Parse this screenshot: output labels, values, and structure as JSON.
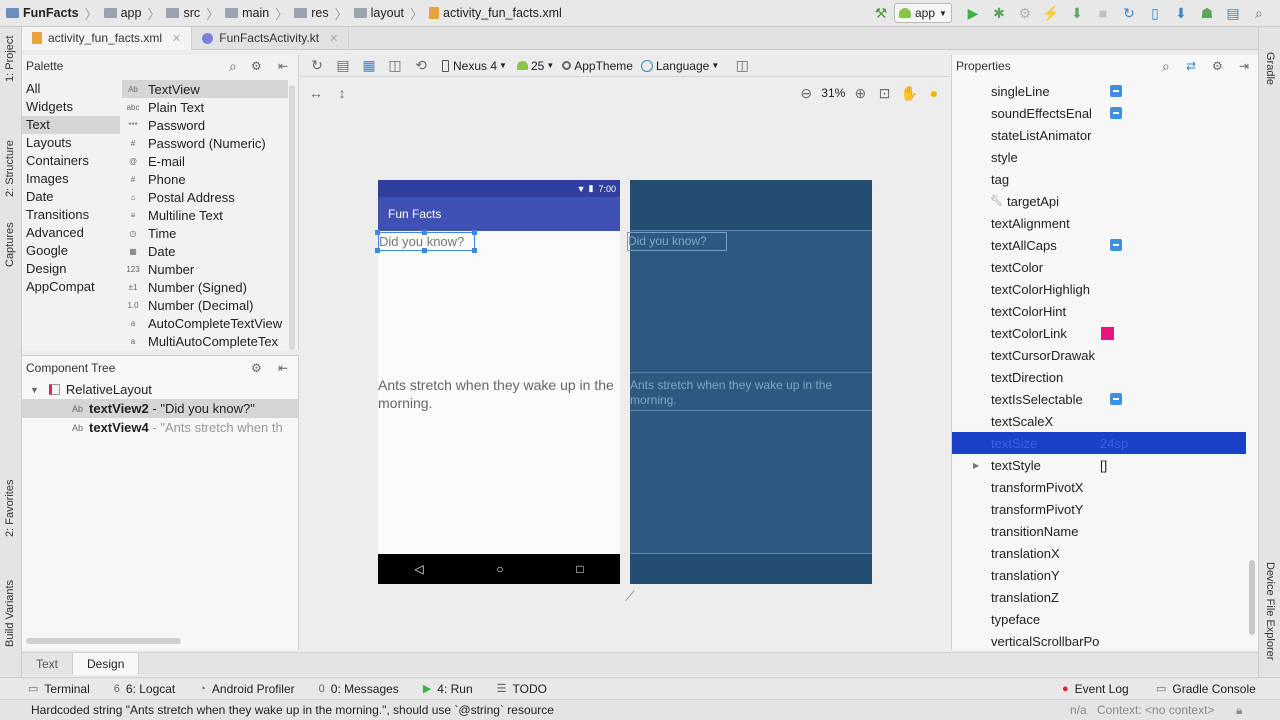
{
  "breadcrumbs": [
    "FunFacts",
    "app",
    "src",
    "main",
    "res",
    "layout",
    "activity_fun_facts.xml"
  ],
  "run_config": "app",
  "editor_tabs": [
    {
      "label": "activity_fun_facts.xml",
      "active": true
    },
    {
      "label": "FunFactsActivity.kt",
      "active": false
    }
  ],
  "left_stripe": [
    "1: Project",
    "2: Structure",
    "Captures",
    "2: Favorites",
    "Build Variants"
  ],
  "right_stripe": [
    "Gradle",
    "Device File Explorer"
  ],
  "palette": {
    "title": "Palette",
    "categories": [
      "All",
      "Widgets",
      "Text",
      "Layouts",
      "Containers",
      "Images",
      "Date",
      "Transitions",
      "Advanced",
      "Google",
      "Design",
      "AppCompat"
    ],
    "selected_category": "Text",
    "items": [
      {
        "icon": "Ab",
        "label": "TextView",
        "selected": true
      },
      {
        "icon": "abc",
        "label": "Plain Text"
      },
      {
        "icon": "***",
        "label": "Password"
      },
      {
        "icon": "#",
        "label": "Password (Numeric)"
      },
      {
        "icon": "@",
        "label": "E-mail"
      },
      {
        "icon": "#",
        "label": "Phone"
      },
      {
        "icon": "⌂",
        "label": "Postal Address"
      },
      {
        "icon": "≡",
        "label": "Multiline Text"
      },
      {
        "icon": "◷",
        "label": "Time"
      },
      {
        "icon": "▦",
        "label": "Date"
      },
      {
        "icon": "123",
        "label": "Number"
      },
      {
        "icon": "±1",
        "label": "Number (Signed)"
      },
      {
        "icon": "1.0",
        "label": "Number (Decimal)"
      },
      {
        "icon": "a",
        "label": "AutoCompleteTextView"
      },
      {
        "icon": "a",
        "label": "MultiAutoCompleteTex"
      }
    ]
  },
  "design_toolbar": {
    "device": "Nexus 4",
    "api": "25",
    "theme": "AppTheme",
    "language": "Language",
    "zoom": "31%"
  },
  "component_tree": {
    "title": "Component Tree",
    "root": "RelativeLayout",
    "children": [
      {
        "icon": "Ab",
        "id": "textView2",
        "text": "- \"Did you know?\"",
        "selected": true
      },
      {
        "icon": "Ab",
        "id": "textView4",
        "text": "- \"Ants stretch when th"
      }
    ]
  },
  "phone": {
    "time": "7:00",
    "app_title": "Fun Facts",
    "text1": "Did you know?",
    "text2": "Ants stretch when they wake up in the morning."
  },
  "properties": {
    "title": "Properties",
    "rows": [
      {
        "name": "singleLine",
        "flag": true
      },
      {
        "name": "soundEffectsEnal",
        "flag": true
      },
      {
        "name": "stateListAnimator"
      },
      {
        "name": "style"
      },
      {
        "name": "tag"
      },
      {
        "name": "targetApi",
        "wrench": true
      },
      {
        "name": "textAlignment"
      },
      {
        "name": "textAllCaps",
        "flag": true
      },
      {
        "name": "textColor"
      },
      {
        "name": "textColorHighligh"
      },
      {
        "name": "textColorHint"
      },
      {
        "name": "textColorLink",
        "swatch": "#e5177e"
      },
      {
        "name": "textCursorDrawak"
      },
      {
        "name": "textDirection"
      },
      {
        "name": "textIsSelectable",
        "flag": true
      },
      {
        "name": "textScaleX"
      },
      {
        "name": "textSize",
        "value": "24sp",
        "selected": true
      },
      {
        "name": "textStyle",
        "value": "[]",
        "expandable": true
      },
      {
        "name": "transformPivotX"
      },
      {
        "name": "transformPivotY"
      },
      {
        "name": "transitionName"
      },
      {
        "name": "translationX"
      },
      {
        "name": "translationY"
      },
      {
        "name": "translationZ"
      },
      {
        "name": "typeface"
      },
      {
        "name": "verticalScrollbarPo"
      }
    ]
  },
  "design_tabs": [
    "Text",
    "Design"
  ],
  "active_design_tab": "Design",
  "tool_windows_left": [
    {
      "icon": "▭",
      "label": "Terminal"
    },
    {
      "icon": "6",
      "label": "6: Logcat"
    },
    {
      "icon": "◔",
      "label": "Android Profiler"
    },
    {
      "icon": "0",
      "label": "0: Messages"
    },
    {
      "icon": "▶",
      "label": "4: Run"
    },
    {
      "icon": "☰",
      "label": "TODO"
    }
  ],
  "tool_windows_right": [
    {
      "icon": "●",
      "label": "Event Log"
    },
    {
      "icon": "▭",
      "label": "Gradle Console"
    }
  ],
  "status": {
    "message": "Hardcoded string \"Ants stretch when they wake up in the morning.\", should use `@string` resource",
    "na": "n/a",
    "context": "Context: <no context>"
  },
  "colors": {
    "appbar": "#3f51b5",
    "statusbar": "#303f9f",
    "blueprint": "#2d5980",
    "selection": "#1a3fc8"
  }
}
